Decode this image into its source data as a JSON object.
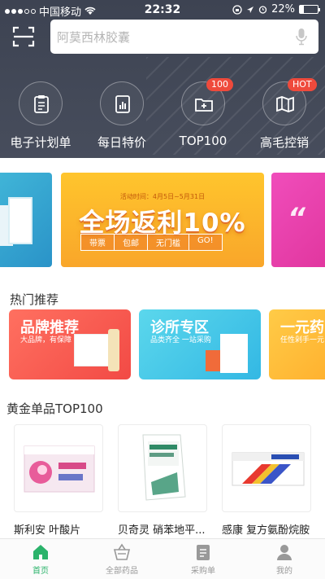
{
  "status_bar": {
    "carrier": "中国移动",
    "time": "22:32",
    "battery": "22%",
    "battery_level": 0.22
  },
  "search": {
    "placeholder": "阿莫西林胶囊"
  },
  "quick_links": [
    {
      "label": "电子计划单",
      "icon": "clipboard-icon",
      "badge": ""
    },
    {
      "label": "每日特价",
      "icon": "chart-doc-icon",
      "badge": ""
    },
    {
      "label": "TOP100",
      "icon": "plus-folder-icon",
      "badge": "100"
    },
    {
      "label": "高毛控销",
      "icon": "map-icon",
      "badge": "HOT"
    }
  ],
  "banner": {
    "date": "活动时间：4月5日~5月31日",
    "title": "全场返利10%",
    "tags": [
      "带票",
      "包邮",
      "无门槛",
      "GO!"
    ]
  },
  "hot_section": {
    "title": "热门推荐",
    "cards": [
      {
        "title": "品牌推荐",
        "subtitle": "大品牌，有保障"
      },
      {
        "title": "诊所专区",
        "subtitle": "品类齐全 一站采购"
      },
      {
        "title": "一元药",
        "subtitle": "任性剁手一元"
      }
    ]
  },
  "top_section": {
    "title": "黄金单品TOP100",
    "products": [
      {
        "name": "斯利安 叶酸片"
      },
      {
        "name": "贝奇灵 硝苯地平..."
      },
      {
        "name": "感康 复方氨酚烷胺"
      }
    ]
  },
  "tabbar": [
    {
      "label": "首页",
      "active": true
    },
    {
      "label": "全部药品",
      "active": false
    },
    {
      "label": "采购单",
      "active": false
    },
    {
      "label": "我的",
      "active": false
    }
  ],
  "colors": {
    "header": "#40475a",
    "accent_green": "#2bb36b",
    "badge_red": "#ef4a3c"
  }
}
